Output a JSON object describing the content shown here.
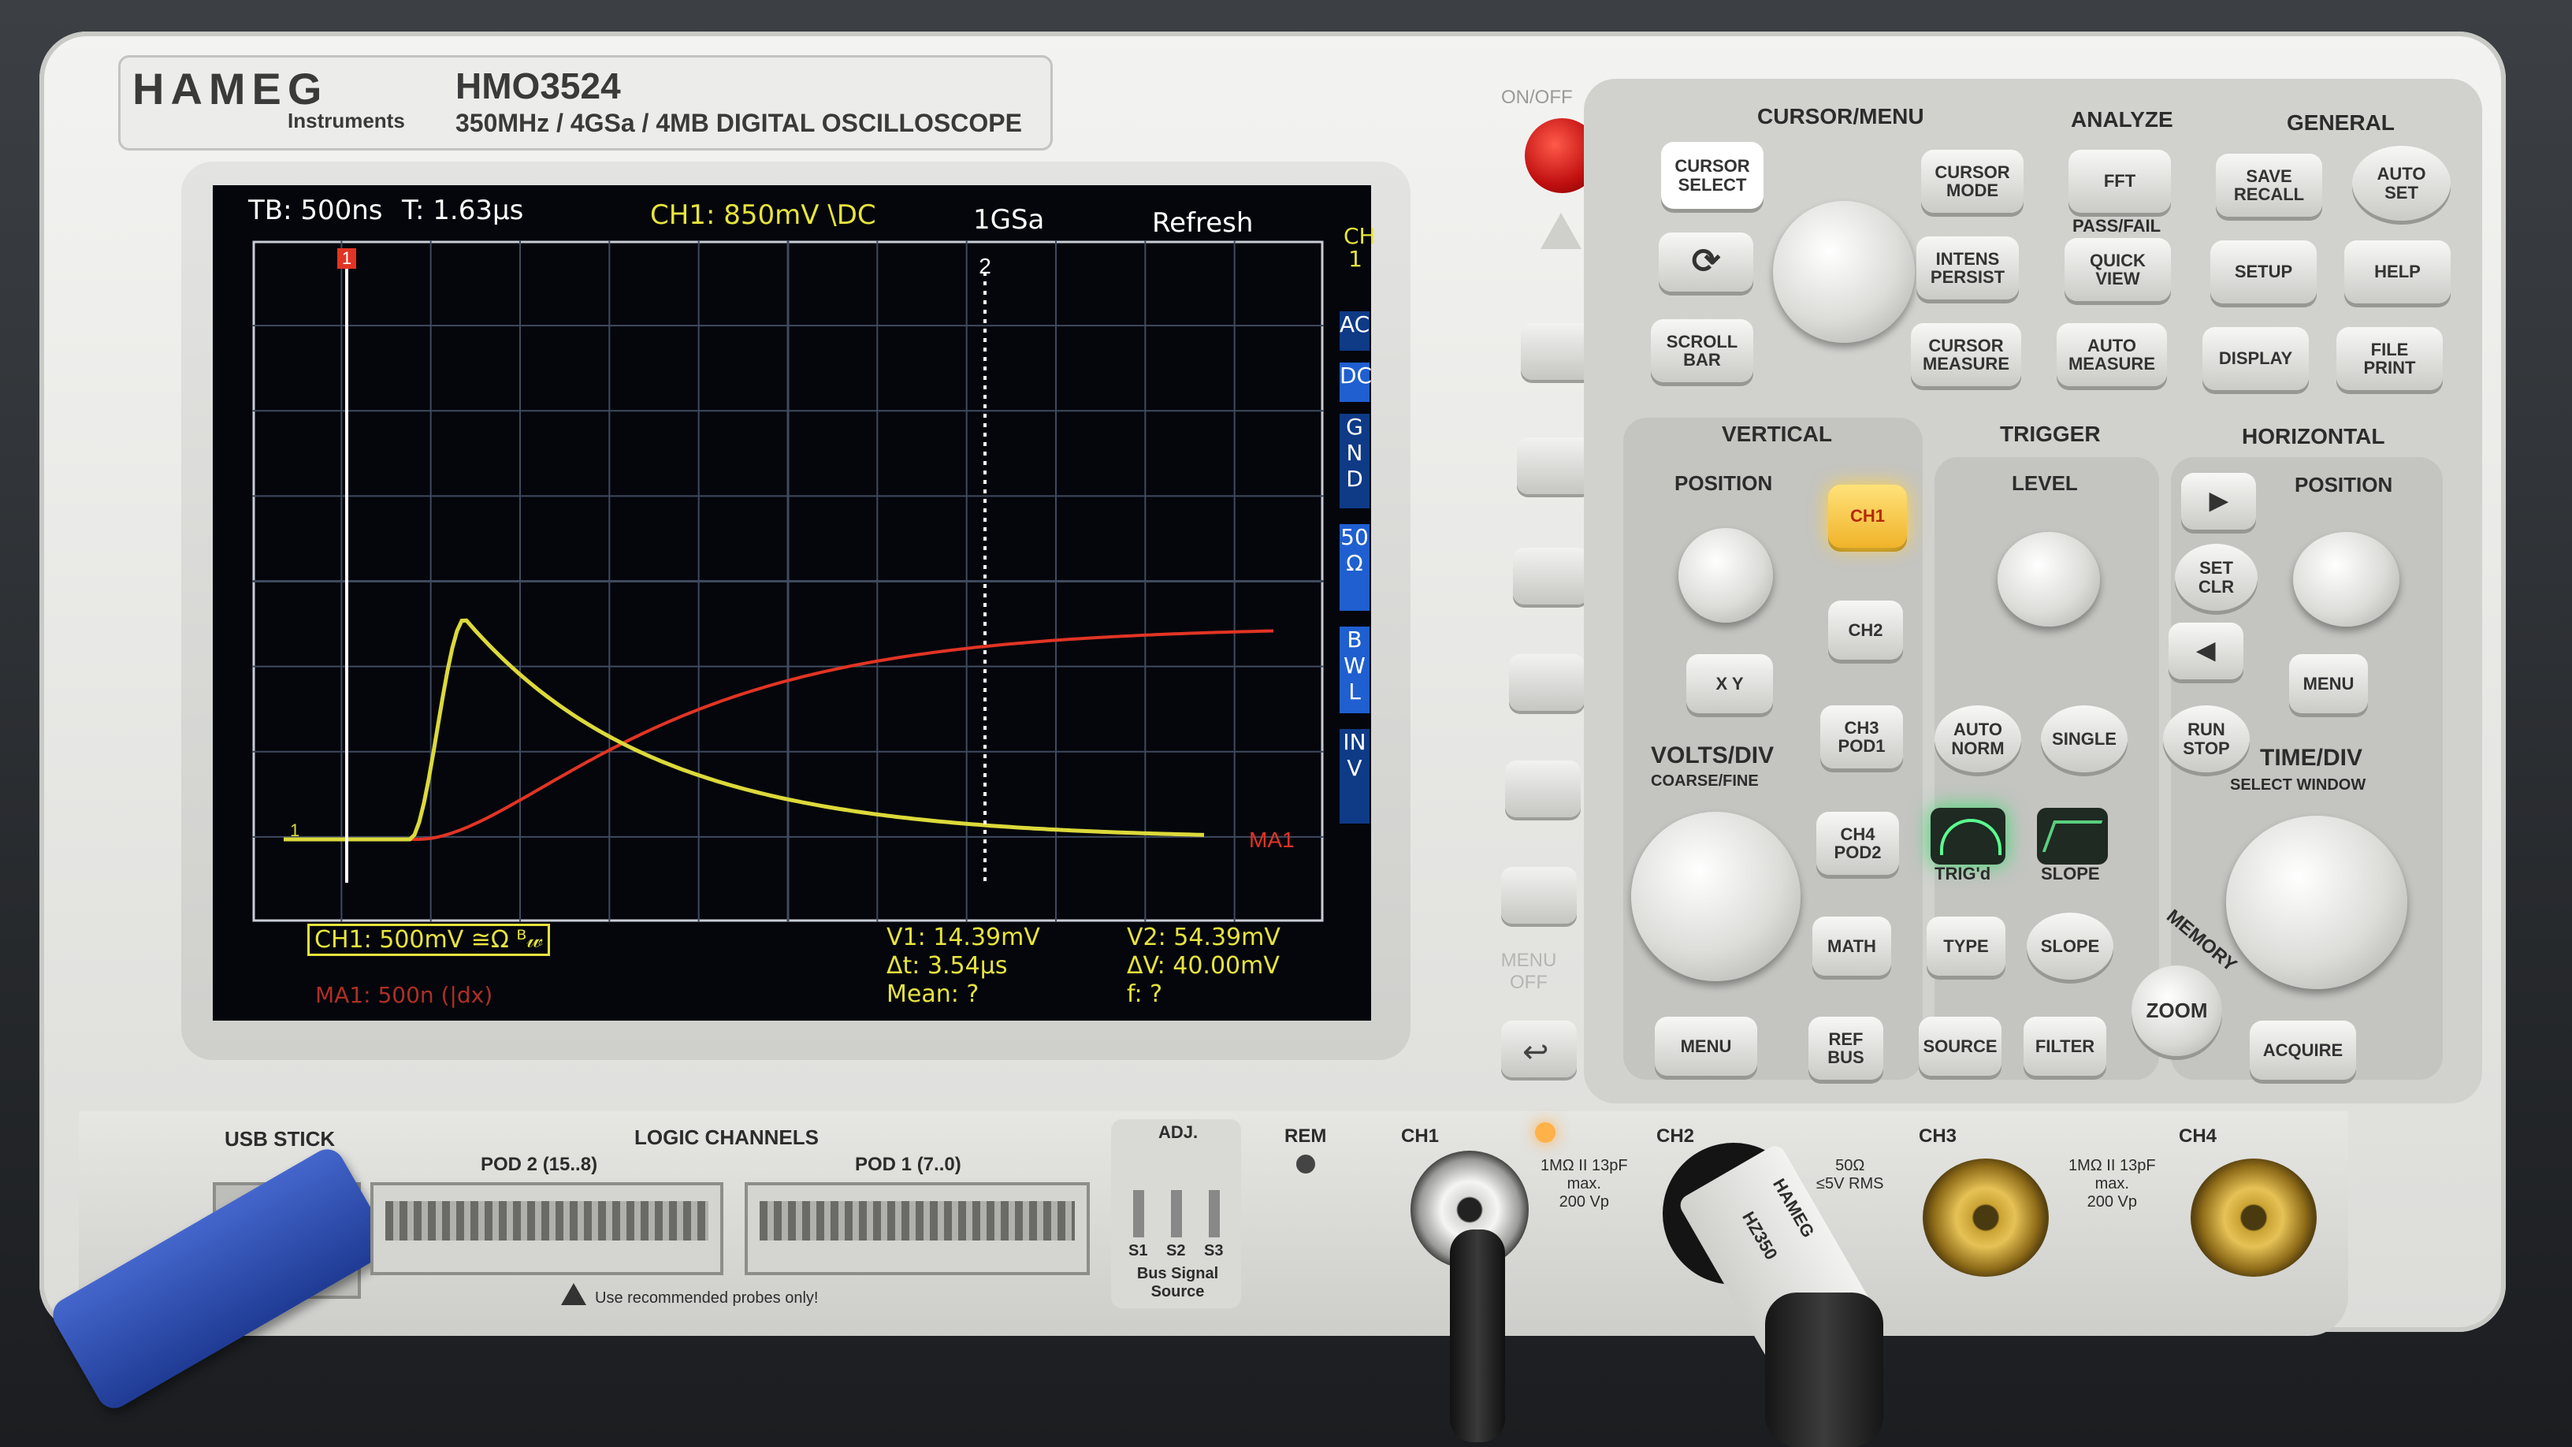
{
  "brand": {
    "logo": "HAMEG",
    "sub": "Instruments",
    "model": "HMO3524",
    "spec": "350MHz / 4GSa / 4MB DIGITAL OSCILLOSCOPE",
    "onoff": "ON/OFF",
    "menu_off": "MENU OFF"
  },
  "screen": {
    "tb": "TB: 500ns",
    "t": "T: 1.63µs",
    "ch1_trig": "CH1: 850mV \\DC",
    "rate": "1GSa",
    "mode": "Refresh",
    "side_label": "CH 1",
    "side_tabs": [
      "AC",
      "DC",
      "GND",
      "50 Ω",
      "BWL",
      "INV"
    ],
    "cursor1": "1",
    "cursor2": "2",
    "marker1": "1",
    "ma1_tag": "MA1",
    "ch1_scale": "CH1: 500mV ≅Ω ᴮ𝓌",
    "v1": "V1: 14.39mV",
    "v2": "V2: 54.39mV",
    "dt": "Δt: 3.54µs",
    "dv": "ΔV: 40.00mV",
    "mean": "Mean: ?",
    "freq": "f: ?",
    "ma1": "MA1: 500n (|dx)"
  },
  "panel": {
    "sections": {
      "cursor_menu": "CURSOR/MENU",
      "analyze": "ANALYZE",
      "general": "GENERAL",
      "vertical": "VERTICAL",
      "trigger": "TRIGGER",
      "horizontal": "HORIZONTAL"
    },
    "labels": {
      "position": "POSITION",
      "level": "LEVEL",
      "position_h": "POSITION",
      "volts_div": "VOLTS/DIV",
      "coarse_fine": "COARSE/FINE",
      "time_div": "TIME/DIV",
      "select_window": "SELECT WINDOW",
      "pass_fail": "PASS/FAIL",
      "trigd": "TRIG'd",
      "slope_lbl": "SLOPE",
      "memory": "MEMORY"
    },
    "keys": {
      "cursor_select": "CURSOR\nSELECT",
      "cursor_mode": "CURSOR\nMODE",
      "fft": "FFT",
      "save_recall": "SAVE\nRECALL",
      "auto_set": "AUTO\nSET",
      "intens_persist": "INTENS\nPERSIST",
      "quick_view": "QUICK\nVIEW",
      "setup": "SETUP",
      "help": "HELP",
      "scroll_bar": "SCROLL\nBAR",
      "cursor_measure": "CURSOR\nMEASURE",
      "auto_measure": "AUTO\nMEASURE",
      "display": "DISPLAY",
      "file_print": "FILE\nPRINT",
      "ch1": "CH1",
      "ch2": "CH2",
      "ch3": "CH3\nPOD1",
      "ch4": "CH4\nPOD2",
      "xy": "X Y",
      "math": "MATH",
      "menu_v": "MENU",
      "ref_bus": "REF\nBUS",
      "auto_norm": "AUTO\nNORM",
      "single": "SINGLE",
      "type": "TYPE",
      "slope": "SLOPE",
      "source": "SOURCE",
      "filter": "FILTER",
      "set_clr": "SET\nCLR",
      "run_stop": "RUN\nSTOP",
      "menu_h": "MENU",
      "zoom": "ZOOM",
      "acquire": "ACQUIRE"
    }
  },
  "front": {
    "usb_stick": "USB STICK",
    "logic_channels": "LOGIC CHANNELS",
    "pod2": "POD 2 (15..8)",
    "pod1": "POD 1 (7..0)",
    "adj": "ADJ.",
    "s1": "S1",
    "s2": "S2",
    "s3": "S3",
    "bus_signal": "Bus Signal\nSource",
    "rem": "REM",
    "warning": "Use recommended probes only!",
    "ch1": "CH1",
    "ch2": "CH2",
    "ch3": "CH3",
    "ch4": "CH4",
    "input_spec": "1MΩ II 13pF\nmax.\n200 Vp",
    "input_50": "50Ω\n≤5V RMS",
    "input_spec2": "1MΩ II 13pF\nmax.\n200 Vp",
    "probe_brand": "HAMEG",
    "probe_model": "HZ350"
  },
  "colors": {
    "ch1_trace": "#dcd93a",
    "math_trace": "#e23424",
    "grid": "#3f4a5e",
    "key_lit": "#f5c63a",
    "trig_lit": "#39d96b"
  }
}
